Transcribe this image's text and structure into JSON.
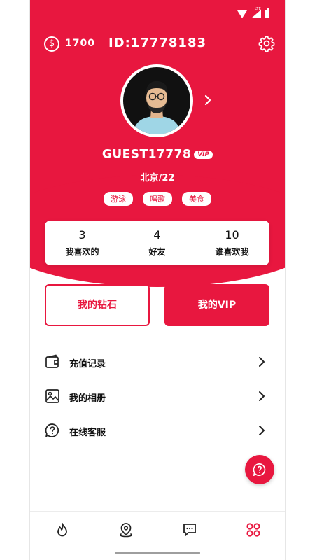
{
  "colors": {
    "accent": "#E8173F",
    "background": "#FFFFFF",
    "text": "#111111"
  },
  "status_bar": {
    "network_label": "LTE"
  },
  "header": {
    "coin_symbol": "$",
    "coin_count": "1700",
    "user_id": "ID:17778183",
    "settings_icon": "gear-icon"
  },
  "profile": {
    "username": "GUEST17778",
    "vip_badge": "VIP",
    "location": "北京/22",
    "tags": [
      "游泳",
      "唱歌",
      "美食"
    ]
  },
  "stats": [
    {
      "value": "3",
      "label": "我喜欢的"
    },
    {
      "value": "4",
      "label": "好友"
    },
    {
      "value": "10",
      "label": "谁喜欢我"
    }
  ],
  "actions": {
    "diamonds_label": "我的钻石",
    "vip_label": "我的VIP"
  },
  "menu": [
    {
      "label": "充值记录",
      "icon": "wallet-icon"
    },
    {
      "label": "我的相册",
      "icon": "photo-album-icon"
    },
    {
      "label": "在线客服",
      "icon": "help-chat-icon"
    }
  ],
  "bottom_nav": [
    {
      "icon": "flame-icon"
    },
    {
      "icon": "location-pin-icon"
    },
    {
      "icon": "chat-icon"
    },
    {
      "icon": "apps-grid-icon",
      "active": true
    }
  ]
}
